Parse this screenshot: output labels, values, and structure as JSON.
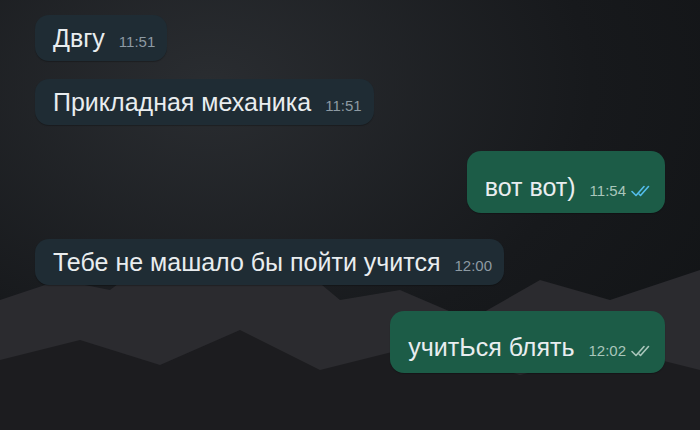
{
  "messages": [
    {
      "kind": "incoming",
      "text": "Двгу",
      "time": "11:51"
    },
    {
      "kind": "incoming",
      "text": "Прикладная механика",
      "time": "11:51"
    },
    {
      "kind": "outgoing",
      "text": "вот вот)",
      "time": "11:54",
      "read": true
    },
    {
      "kind": "incoming",
      "text": "Тебе не машало бы пойти учится",
      "time": "12:00"
    },
    {
      "kind": "outgoing",
      "text": "учитЬся блять",
      "time": "12:02",
      "read": false
    }
  ]
}
